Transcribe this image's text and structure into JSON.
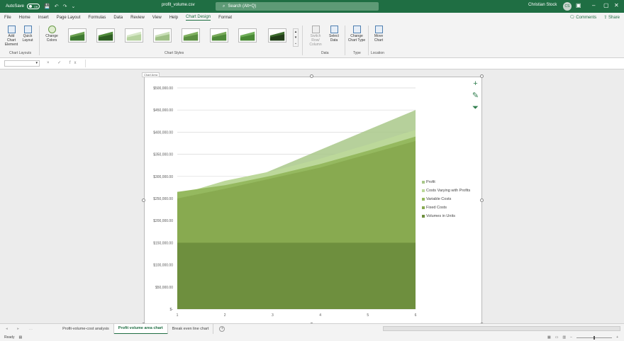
{
  "titlebar": {
    "autosave": "AutoSave",
    "toggle": "Off",
    "filename": "profit_volume.csv",
    "search": "Search (Alt+Q)",
    "user": "Christian Stock",
    "user_initials": "CS"
  },
  "tabs": [
    "File",
    "Home",
    "Insert",
    "Page Layout",
    "Formulas",
    "Data",
    "Review",
    "View",
    "Help",
    "Chart Design",
    "Format"
  ],
  "ribbon_right": {
    "comments": "Comments",
    "share": "Share"
  },
  "ribbon": {
    "add_chart_element": "Add Chart Element",
    "quick_layout": "Quick Layout",
    "change_colors": "Change Colors",
    "group_chart_layouts": "Chart Layouts",
    "group_chart_styles": "Chart Styles",
    "switch_row_column": "Switch Row/ Column",
    "select_data": "Select Data",
    "group_data": "Data",
    "change_chart_type": "Change Chart Type",
    "group_type": "Type",
    "move_chart": "Move Chart",
    "group_location": "Location"
  },
  "formula_bar": {
    "name_box": "",
    "buttons": "× ✓ fx"
  },
  "chart_tag": "Chart Area",
  "chart_data": {
    "type": "area",
    "x": [
      1,
      2,
      3,
      4,
      5,
      6
    ],
    "ylim": [
      0,
      500000
    ],
    "yticks": [
      "$-",
      "$50,000.00",
      "$100,000.00",
      "$150,000.00",
      "$200,000.00",
      "$250,000.00",
      "$300,000.00",
      "$350,000.00",
      "$400,000.00",
      "$450,000.00",
      "$500,000.00"
    ],
    "series": [
      {
        "name": "Profit",
        "values": [
          225000,
          270000,
          315000,
          360000,
          405000,
          450000
        ],
        "color": "#a9c88a"
      },
      {
        "name": "Costs Varying with Profits",
        "values": [
          258000,
          290000,
          312000,
          340000,
          372000,
          405000
        ],
        "color": "#bcd89a"
      },
      {
        "name": "Variable Costs",
        "values": [
          265000,
          280000,
          302000,
          328000,
          358000,
          390000
        ],
        "color": "#95b95f"
      },
      {
        "name": "Fixed Costs",
        "values": [
          250000,
          272000,
          296000,
          320000,
          350000,
          380000
        ],
        "color": "#88aa50"
      },
      {
        "name": "Volumes in Units",
        "values": [
          150000,
          150000,
          150000,
          150000,
          150000,
          150000
        ],
        "color": "#6e8f3e"
      }
    ]
  },
  "sheets": [
    "Profit-volume-cost analysis",
    "Profit volume area chart",
    "Break even line chart"
  ],
  "active_sheet": 1,
  "status": {
    "ready": "Ready"
  }
}
